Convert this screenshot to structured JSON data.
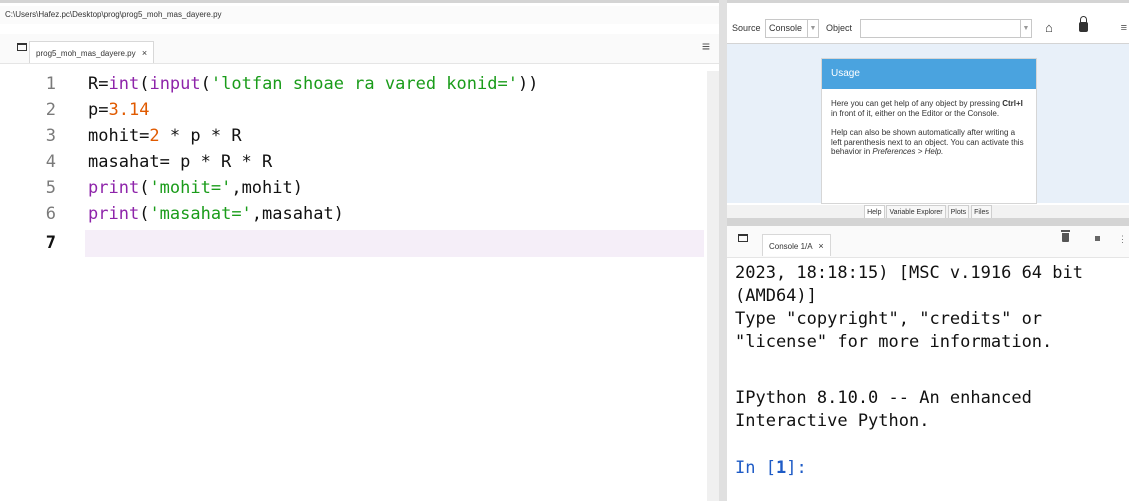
{
  "editor": {
    "file_path": "C:\\Users\\Hafez.pc\\Desktop\\prog\\prog5_moh_mas_dayere.py",
    "tab_label": "prog5_moh_mas_dayere.py",
    "tab_close": "×",
    "menu_glyph": "≡",
    "line_numbers": [
      "1",
      "2",
      "3",
      "4",
      "5",
      "6",
      "7"
    ],
    "code_lines": [
      "R=int(input('lotfan shoae ra vared konid='))",
      "p=3.14",
      "mohit=2 * p * R",
      "masahat= p * R * R",
      "print('mohit=',mohit)",
      "print('masahat=',masahat)",
      ""
    ],
    "active_line": "7"
  },
  "help": {
    "source_label": "Source",
    "source_value": "Console",
    "object_label": "Object",
    "object_value": "",
    "usage_title": "Usage",
    "usage_p1_a": "Here you can get help of any object by pressing ",
    "usage_p1_b": "Ctrl+I",
    "usage_p1_c": " in front of it, either on the Editor or the Console.",
    "usage_p2_a": "Help can also be shown automatically after writing a left parenthesis next to an object. You can activate this behavior in ",
    "usage_p2_b": "Preferences > Help.",
    "tabs": [
      "Help",
      "Variable Explorer",
      "Plots",
      "Files"
    ],
    "active_tab": "Help"
  },
  "console": {
    "tab_label": "Console 1/A",
    "tab_close": "×",
    "output_1": "2023, 18:18:15) [MSC v.1916 64 bit (AMD64)]",
    "output_2": "Type \"copyright\", \"credits\" or \"license\" for more information.",
    "output_3": "IPython 8.10.0 -- An enhanced Interactive Python.",
    "prompt_word": "In [",
    "prompt_num": "1",
    "prompt_end": "]:"
  },
  "icons": {
    "editor_pane": "pane-window-icon",
    "home": "home-icon",
    "lock": "lock-icon",
    "trash": "trash-icon",
    "stop": "stop-icon"
  },
  "colors": {
    "keyword": "#8e24aa",
    "string": "#1a9c1a",
    "number": "#e05a00",
    "usage_header": "#4aa3df",
    "current_line": "#f5eef8",
    "prompt": "#1e5bc6"
  }
}
